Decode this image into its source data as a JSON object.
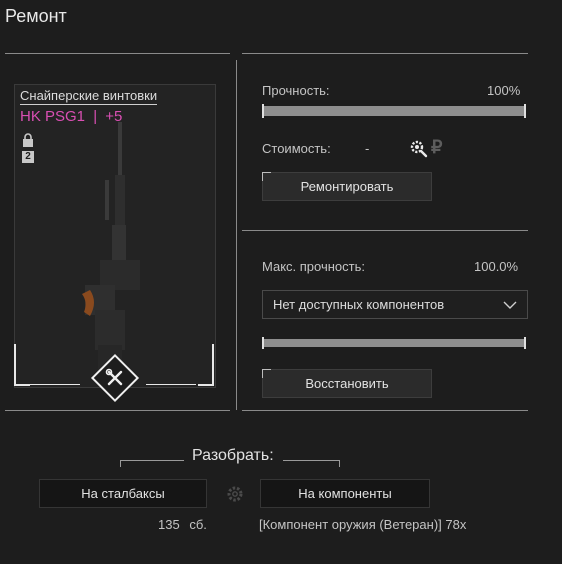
{
  "window": {
    "title": "Ремонт"
  },
  "item": {
    "category": "Снайперские винтовки",
    "name": "HK PSG1",
    "separator": "|",
    "upgrade": "+5",
    "lock_icon": "lock-icon",
    "rank_badge": "2",
    "image": "sniper-rifle-image",
    "badge_icon": "wrench-screwdriver-icon"
  },
  "repair": {
    "durability_label": "Прочность:",
    "durability_value": "100%",
    "durability_fraction": 1.0,
    "cost_label": "Стоимость:",
    "cost_value": "-",
    "cost_icons": [
      "gear-search-icon",
      "ruble-icon"
    ],
    "ruble_symbol": "₽",
    "repair_button": "Ремонтировать"
  },
  "restore": {
    "max_durability_label": "Макс. прочность:",
    "max_durability_value": "100.0%",
    "max_durability_fraction": 1.0,
    "component_select": "Нет доступных компонентов",
    "restore_button": "Восстановить"
  },
  "disassemble": {
    "title": "Разобрать:",
    "to_stalbucks_button": "На сталбаксы",
    "stalbucks_amount": "135",
    "stalbucks_unit": "сб.",
    "to_components_button": "На компоненты",
    "components_result": "[Компонент оружия (Ветеран)] 78x",
    "middle_icon": "gear-icon"
  },
  "colors": {
    "accent_pink": "#d94fb3",
    "background": "#1d1d1d"
  }
}
